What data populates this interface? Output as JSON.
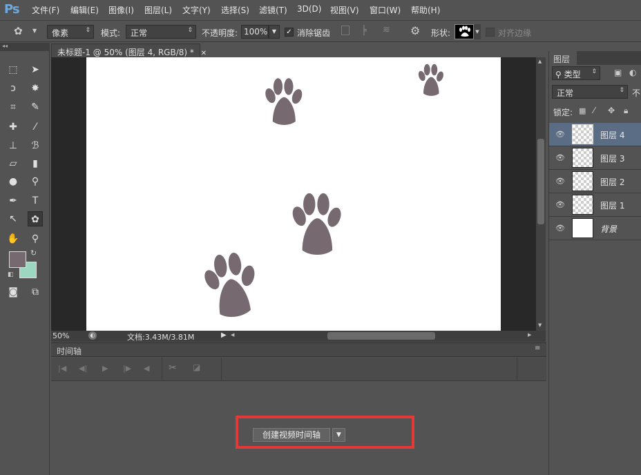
{
  "app": {
    "logo": "Ps"
  },
  "menu": [
    "文件(F)",
    "编辑(E)",
    "图像(I)",
    "图层(L)",
    "文字(Y)",
    "选择(S)",
    "滤镜(T)",
    "3D(D)",
    "视图(V)",
    "窗口(W)",
    "帮助(H)"
  ],
  "options": {
    "pixel_mode": "像素",
    "mode_label": "模式:",
    "mode_value": "正常",
    "opacity_label": "不透明度:",
    "opacity_value": "100%",
    "antialias_label": "消除锯齿",
    "shape_label": "形状:",
    "align_edges_label": "对齐边缘"
  },
  "document": {
    "tab_title": "未标题-1 @ 50% (图层 4, RGB/8) *",
    "zoom": "50%",
    "doc_size": "文档:3.43M/3.81M"
  },
  "timeline": {
    "tab_label": "时间轴",
    "create_button": "创建视频时间轴"
  },
  "layers_panel": {
    "tab_label": "图层",
    "filter_label": "类型",
    "blend_mode": "正常",
    "opacity_partial": "不",
    "lock_label": "锁定:",
    "layers": [
      {
        "name": "图层 4",
        "selected": true
      },
      {
        "name": "图层 3",
        "selected": false
      },
      {
        "name": "图层 2",
        "selected": false
      },
      {
        "name": "图层 1",
        "selected": false
      },
      {
        "name": "背景",
        "selected": false
      }
    ]
  },
  "colors": {
    "foreground": "#766a70",
    "background": "#9cd8c0",
    "highlight": "#e53935",
    "paw": "#766a70"
  }
}
